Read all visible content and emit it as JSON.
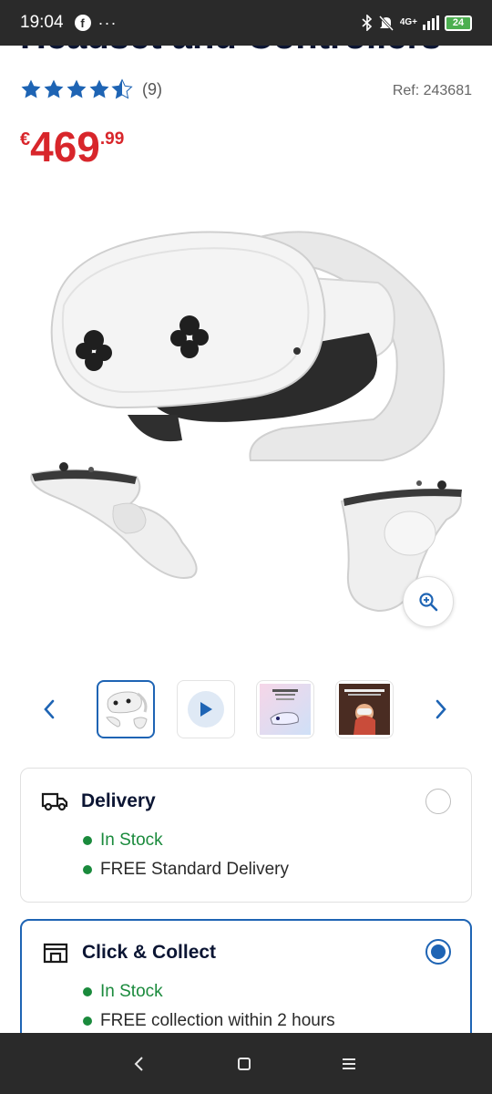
{
  "status_bar": {
    "time": "19:04",
    "facebook_glyph": "f",
    "more_glyph": "···",
    "network": "4G+",
    "battery": "24",
    "icons": [
      "facebook-icon",
      "bluetooth-icon",
      "mute-icon",
      "signal-icon",
      "battery-icon"
    ]
  },
  "product": {
    "title": "Headset and Controllers",
    "rating_value": 4.5,
    "rating_count": "(9)",
    "ref": "Ref: 243681",
    "price": {
      "currency": "€",
      "integer": "469",
      "decimal": ".99"
    },
    "image_icon": "vr-headset-with-controllers-image",
    "zoom_icon": "zoom-in-icon"
  },
  "gallery": {
    "prev_icon": "chevron-left-icon",
    "next_icon": "chevron-right-icon",
    "thumbnails": [
      {
        "kind": "image",
        "icon": "headset-thumb"
      },
      {
        "kind": "video",
        "icon": "play-icon"
      },
      {
        "kind": "image",
        "icon": "battery-promo-thumb"
      },
      {
        "kind": "image",
        "icon": "lifestyle-thumb"
      }
    ],
    "selected_index": 0
  },
  "fulfilment": {
    "delivery": {
      "title": "Delivery",
      "icon": "truck-icon",
      "status": "In Stock",
      "detail": "FREE Standard Delivery",
      "selected": false
    },
    "click_collect": {
      "title": "Click & Collect",
      "icon": "store-icon",
      "status": "In Stock",
      "detail": "FREE collection within 2 hours",
      "selected": true
    }
  },
  "colors": {
    "accent": "#1e64b4",
    "price": "#d8262b",
    "in_stock": "#1a8a3c",
    "star": "#1e64b4",
    "title": "#0b1533"
  },
  "nav_bar": {
    "back_icon": "back-icon",
    "home_icon": "home-icon",
    "menu_icon": "menu-icon"
  }
}
